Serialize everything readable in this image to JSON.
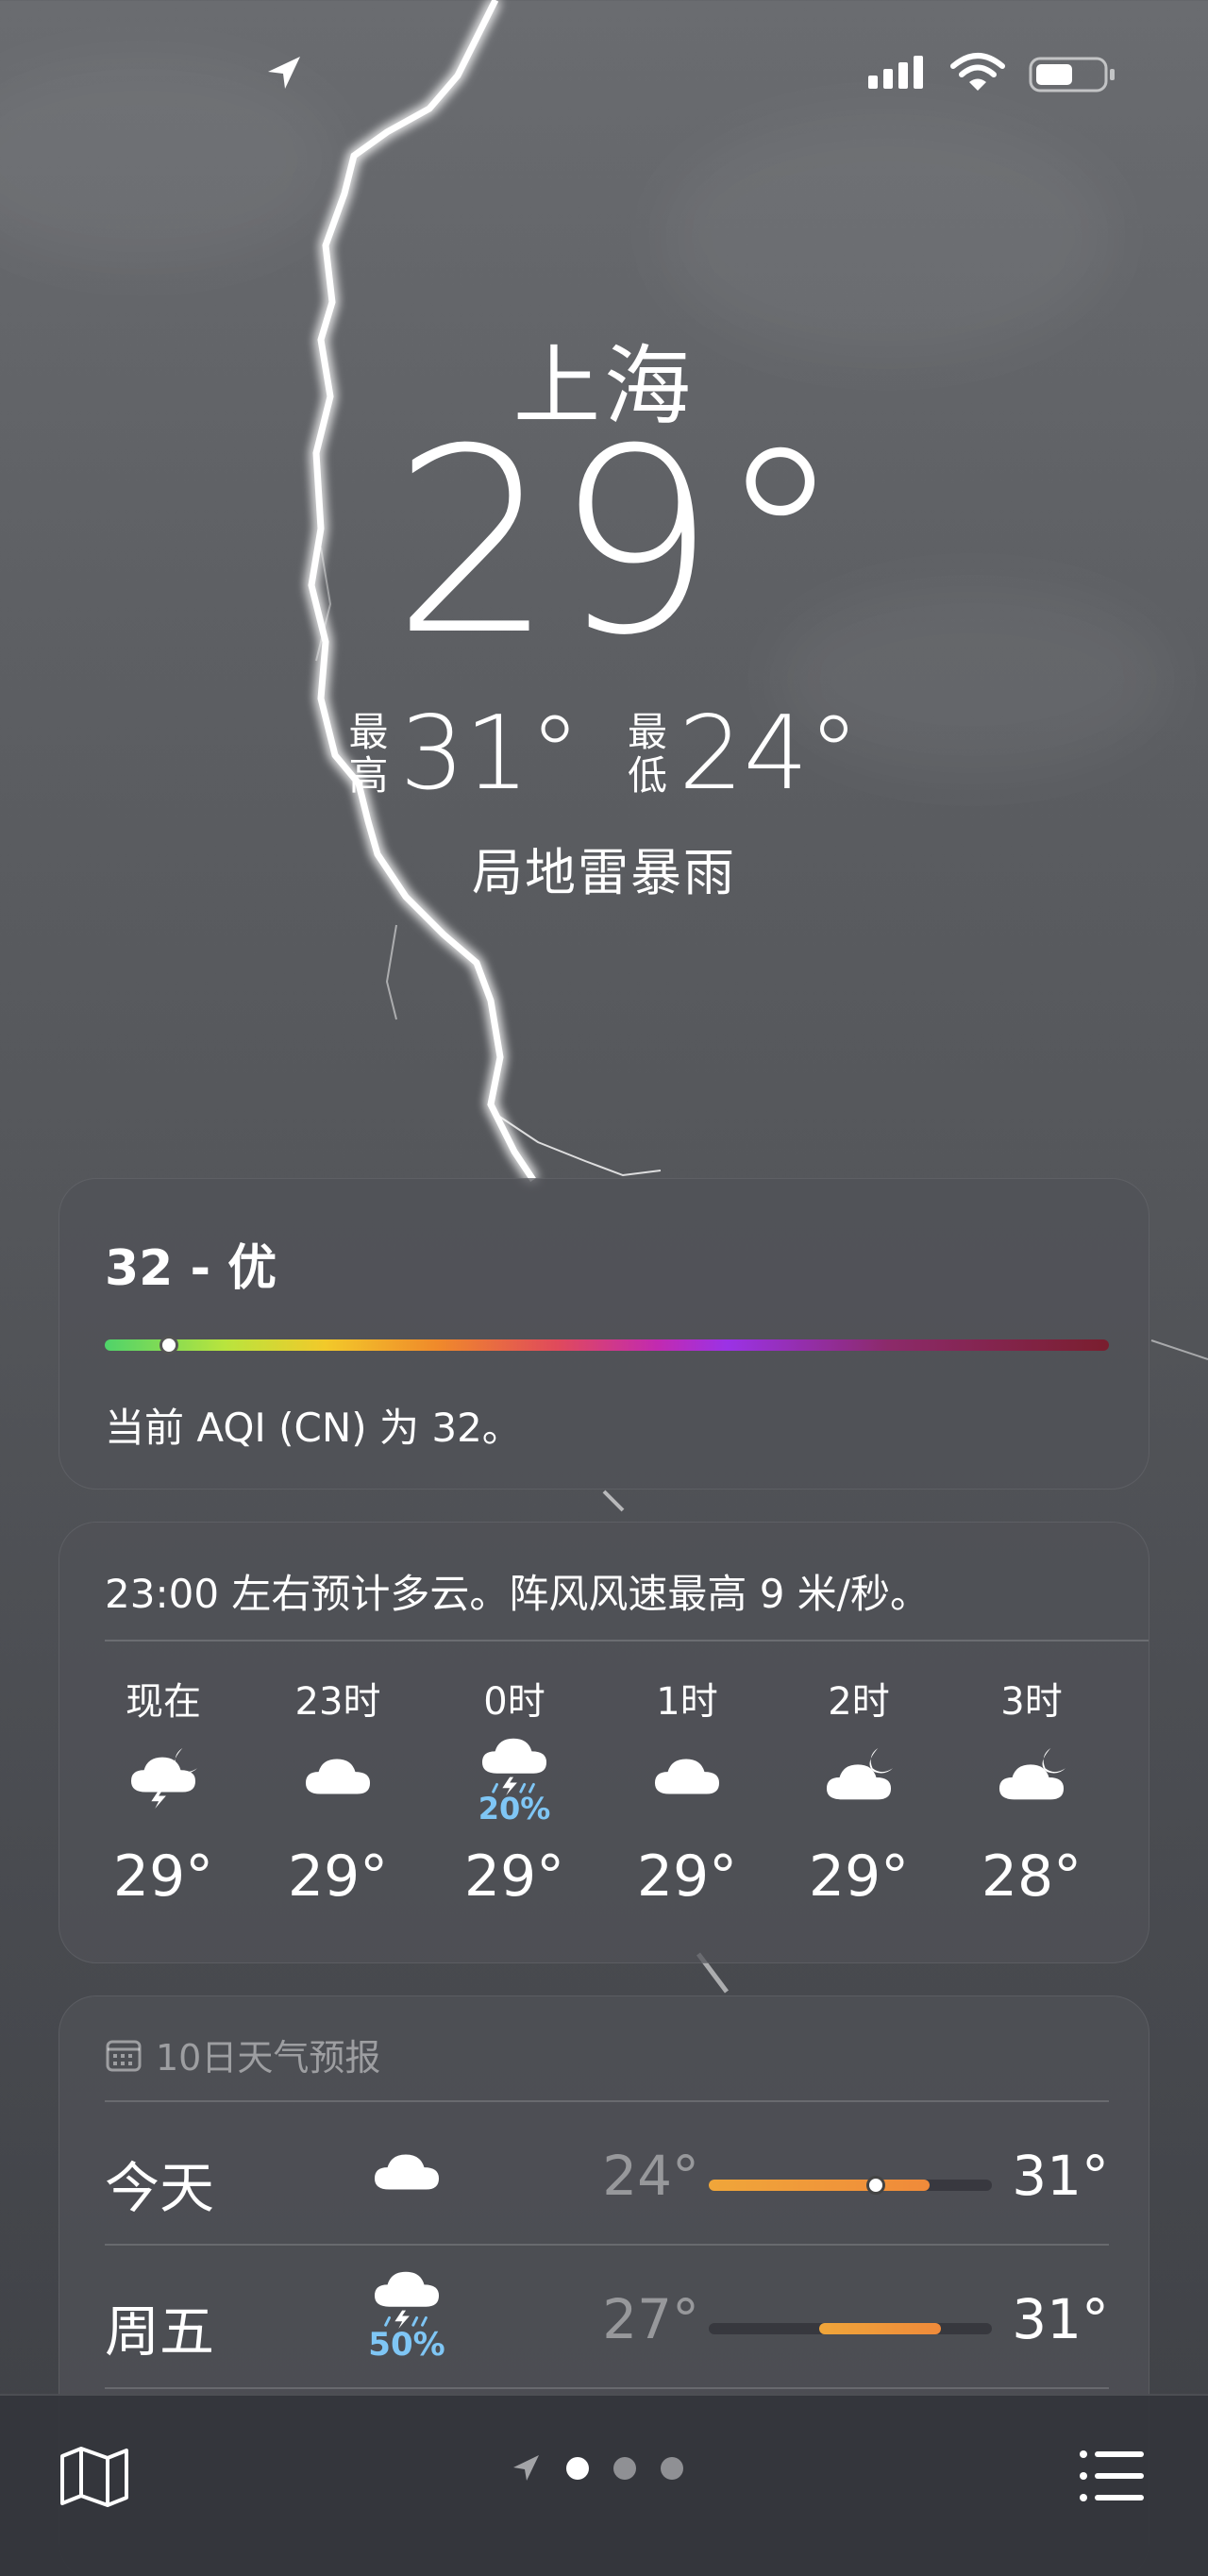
{
  "location": {
    "city": "上海",
    "current_temp": "29°",
    "high_label": "最高",
    "high": "31°",
    "low_label": "最低",
    "low": "24°",
    "condition": "局地雷暴雨"
  },
  "aqi": {
    "title": "32 - 优",
    "description": "当前 AQI (CN) 为 32。",
    "value": 32
  },
  "hourly": {
    "summary": "23:00 左右预计多云。阵风风速最高 9 米/秒。",
    "items": [
      {
        "time": "现在",
        "icon": "cloud-moon-bolt-icon",
        "prob": "",
        "temp": "29°"
      },
      {
        "time": "23时",
        "icon": "cloud-icon",
        "prob": "",
        "temp": "29°"
      },
      {
        "time": "0时",
        "icon": "cloud-bolt-rain-icon",
        "prob": "20%",
        "temp": "29°"
      },
      {
        "time": "1时",
        "icon": "cloud-icon",
        "prob": "",
        "temp": "29°"
      },
      {
        "time": "2时",
        "icon": "cloud-moon-icon",
        "prob": "",
        "temp": "29°"
      },
      {
        "time": "3时",
        "icon": "cloud-moon-icon",
        "prob": "",
        "temp": "28°"
      }
    ]
  },
  "daily": {
    "header": "10日天气预报",
    "days": [
      {
        "name": "今天",
        "icon": "cloud-icon",
        "prob": "",
        "low": "24°",
        "high": "31°",
        "range_start": 0.0,
        "range_end": 0.78,
        "current": 0.59
      },
      {
        "name": "周五",
        "icon": "cloud-bolt-rain-icon",
        "prob": "50%",
        "low": "27°",
        "high": "31°",
        "range_start": 0.39,
        "range_end": 0.82
      }
    ]
  },
  "bottom_bar": {
    "pages": 3,
    "active_page": 0
  },
  "colors": {
    "aqi_good": "#4fd36a",
    "precip_text": "#7fc6f5",
    "temp_range": "#f0a63a"
  }
}
